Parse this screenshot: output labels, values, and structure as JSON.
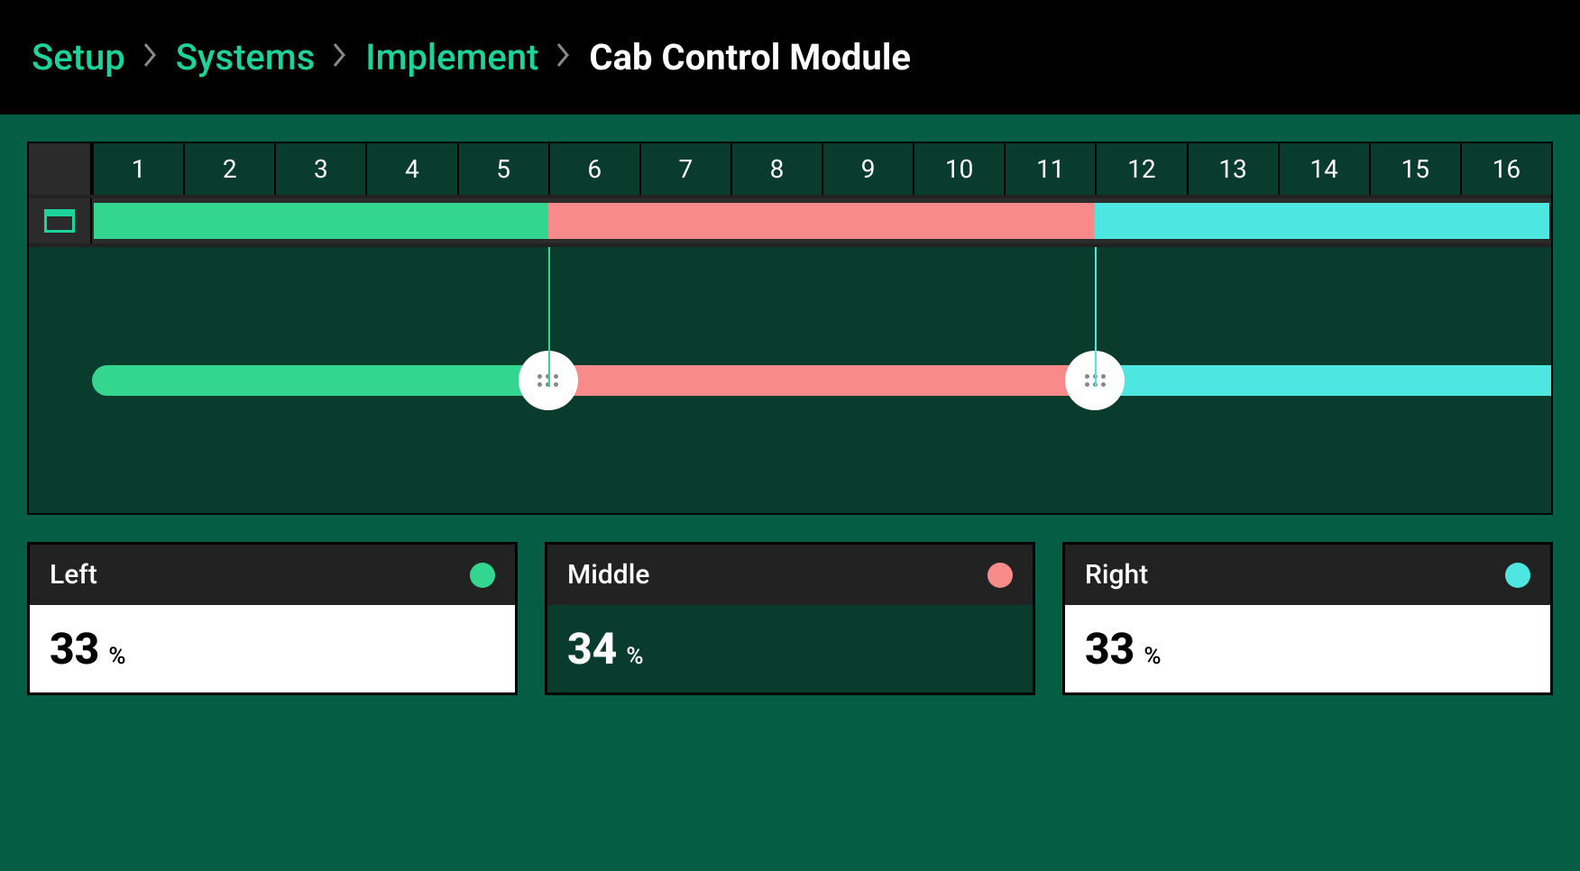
{
  "breadcrumbs": {
    "setup": "Setup",
    "systems": "Systems",
    "implement": "Implement",
    "current": "Cab Control Module"
  },
  "columns": [
    "1",
    "2",
    "3",
    "4",
    "5",
    "6",
    "7",
    "8",
    "9",
    "10",
    "11",
    "12",
    "13",
    "14",
    "15",
    "16"
  ],
  "sections": {
    "left": {
      "label": "Left",
      "value": "33",
      "unit": "%",
      "count": 5
    },
    "middle": {
      "label": "Middle",
      "value": "34",
      "unit": "%",
      "count": 6
    },
    "right": {
      "label": "Right",
      "value": "33",
      "unit": "%",
      "count": 5
    }
  },
  "selected": "middle"
}
